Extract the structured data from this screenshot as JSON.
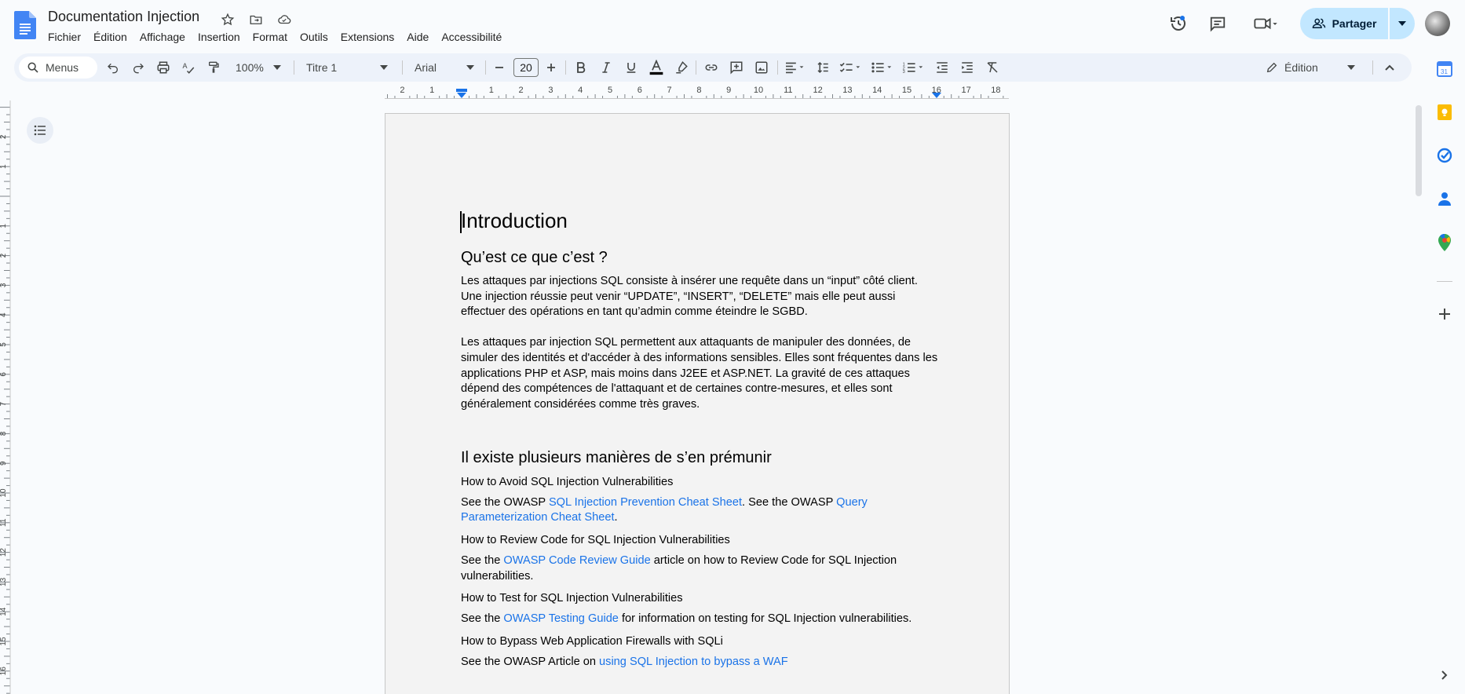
{
  "header": {
    "doc_title": "Documentation Injection",
    "menu": [
      "Fichier",
      "Édition",
      "Affichage",
      "Insertion",
      "Format",
      "Outils",
      "Extensions",
      "Aide",
      "Accessibilité"
    ],
    "share_label": "Partager"
  },
  "toolbar": {
    "search_placeholder": "Menus",
    "zoom": "100%",
    "style": "Titre 1",
    "font": "Arial",
    "font_size": "20",
    "mode": "Édition"
  },
  "ruler": {
    "h_ticks": [
      "2",
      "1",
      "1",
      "2",
      "3",
      "4",
      "5",
      "6",
      "7",
      "8",
      "9",
      "10",
      "11",
      "12",
      "13",
      "14",
      "15",
      "16",
      "17",
      "18"
    ],
    "v_ticks": [
      "2",
      "1",
      "1",
      "2",
      "3",
      "4",
      "5",
      "6",
      "7",
      "8",
      "9",
      "10",
      "11",
      "12",
      "13",
      "14",
      "15",
      "16",
      "17"
    ]
  },
  "document": {
    "h1": "Introduction",
    "h2_1": "Qu’est ce que c’est ?",
    "p1": "Les attaques par injections SQL consiste à insérer une requête dans un “input” côté client. Une injection réussie peut venir “UPDATE”, “INSERT”, “DELETE” mais elle peut aussi effectuer des opérations en tant qu’admin comme éteindre le SGBD.",
    "p2": "Les attaques par injection SQL permettent aux attaquants de manipuler des données, de simuler des identités et d'accéder à des informations sensibles. Elles sont fréquentes dans les applications PHP et ASP, mais moins dans J2EE et ASP.NET. La gravité de ces attaques dépend des compétences de l'attaquant et de certaines contre-mesures, et elles sont généralement considérées comme très graves.",
    "h2_2": "Il existe plusieurs manières de s’en prémunir",
    "s1_title": "How to Avoid SQL Injection Vulnerabilities",
    "s1_a": "See the OWASP ",
    "s1_link1": "SQL Injection Prevention Cheat Sheet",
    "s1_b": ". See the OWASP ",
    "s1_link2": "Query Parameterization Cheat Sheet",
    "s1_c": ".",
    "s2_title": "How to Review Code for SQL Injection Vulnerabilities",
    "s2_a": "See the ",
    "s2_link": "OWASP Code Review Guide",
    "s2_b": " article on how to Review Code for SQL Injection vulnerabilities.",
    "s3_title": "How to Test for SQL Injection Vulnerabilities",
    "s3_a": "See the ",
    "s3_link": "OWASP Testing Guide",
    "s3_b": " for information on testing for SQL Injection vulnerabilities.",
    "s4_title": "How to Bypass Web Application Firewalls with SQLi",
    "s4_a": "See the OWASP Article on ",
    "s4_link": "using SQL Injection to bypass a WAF"
  },
  "colors": {
    "accent": "#1a73e8",
    "share_bg": "#c2e7ff",
    "toolbar_bg": "#edf2fa",
    "page_bg": "#f3f3f3"
  }
}
